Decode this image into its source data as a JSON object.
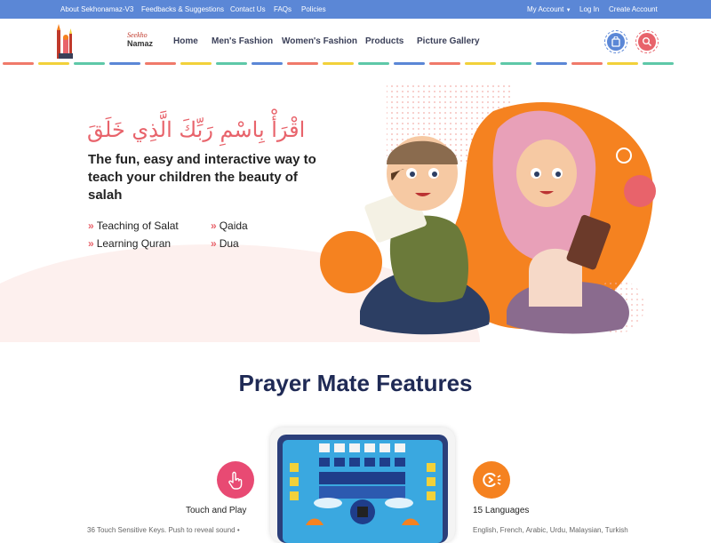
{
  "topbar": {
    "left_links": [
      "About Sekhonamaz-V3",
      "Feedbacks & Suggestions",
      "Contact Us",
      "FAQs",
      "Policies"
    ],
    "my_account": "My Account",
    "login": "Log In",
    "create_account": "Create Account"
  },
  "logo": {
    "line1": "Seekho",
    "line2": "Namaz"
  },
  "nav": [
    "Home",
    "Men's Fashion",
    "Women's Fashion",
    "Products",
    "Picture Gallery"
  ],
  "hero": {
    "arabic": "اقْرَأْ بِاسْمِ رَبِّكَ الَّذِي خَلَقَ",
    "tagline": "The fun, easy and interactive way to teach your children the beauty of salah",
    "features": [
      "Teaching of Salat",
      "Qaida",
      "Learning Quran",
      "Dua"
    ]
  },
  "section": {
    "title": "Prayer Mate Features",
    "left_feature": {
      "title": "Touch and Play",
      "desc": "36 Touch Sensitive Keys. Push to reveal sound •"
    },
    "right_feature": {
      "title": "15 Languages",
      "desc": "English, French, Arabic, Urdu, Malaysian, Turkish"
    }
  },
  "colors": {
    "topbar": "#5b87d6",
    "accent_pink": "#e8636b",
    "accent_orange": "#f58220",
    "heading": "#1f2a55",
    "dash_colors": [
      "#f07a6a",
      "#f2d13a",
      "#5ec8a8",
      "#5b87d6"
    ]
  },
  "icons": [
    "cart-icon",
    "search-icon",
    "touch-hand-icon",
    "languages-icon",
    "chevron-right-icon",
    "caret-down-icon"
  ]
}
